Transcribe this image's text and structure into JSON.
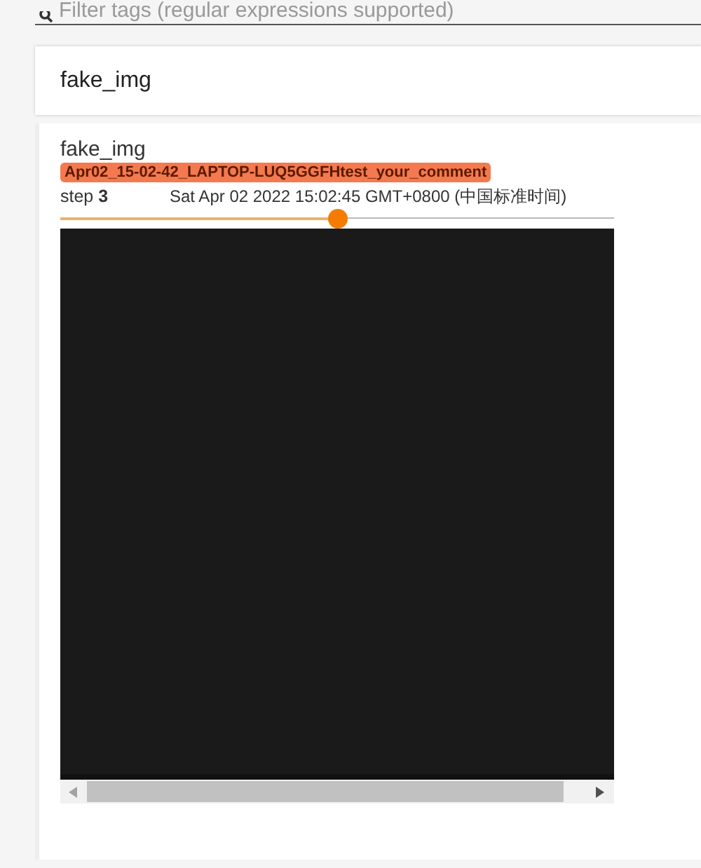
{
  "search": {
    "placeholder": "Filter tags (regular expressions supported)"
  },
  "card": {
    "title": "fake_img",
    "image": {
      "tag": "fake_img",
      "run": {
        "name": "Apr02_15-02-42_LAPTOP-LUQ5GGFHtest_your_comment",
        "color": "#f4794f"
      },
      "step_label": "step",
      "step": "3",
      "timestamp": "Sat Apr 02 2022 15:02:45 GMT+0800 (中国标准时间)",
      "slider": {
        "level": 0.5
      }
    }
  }
}
